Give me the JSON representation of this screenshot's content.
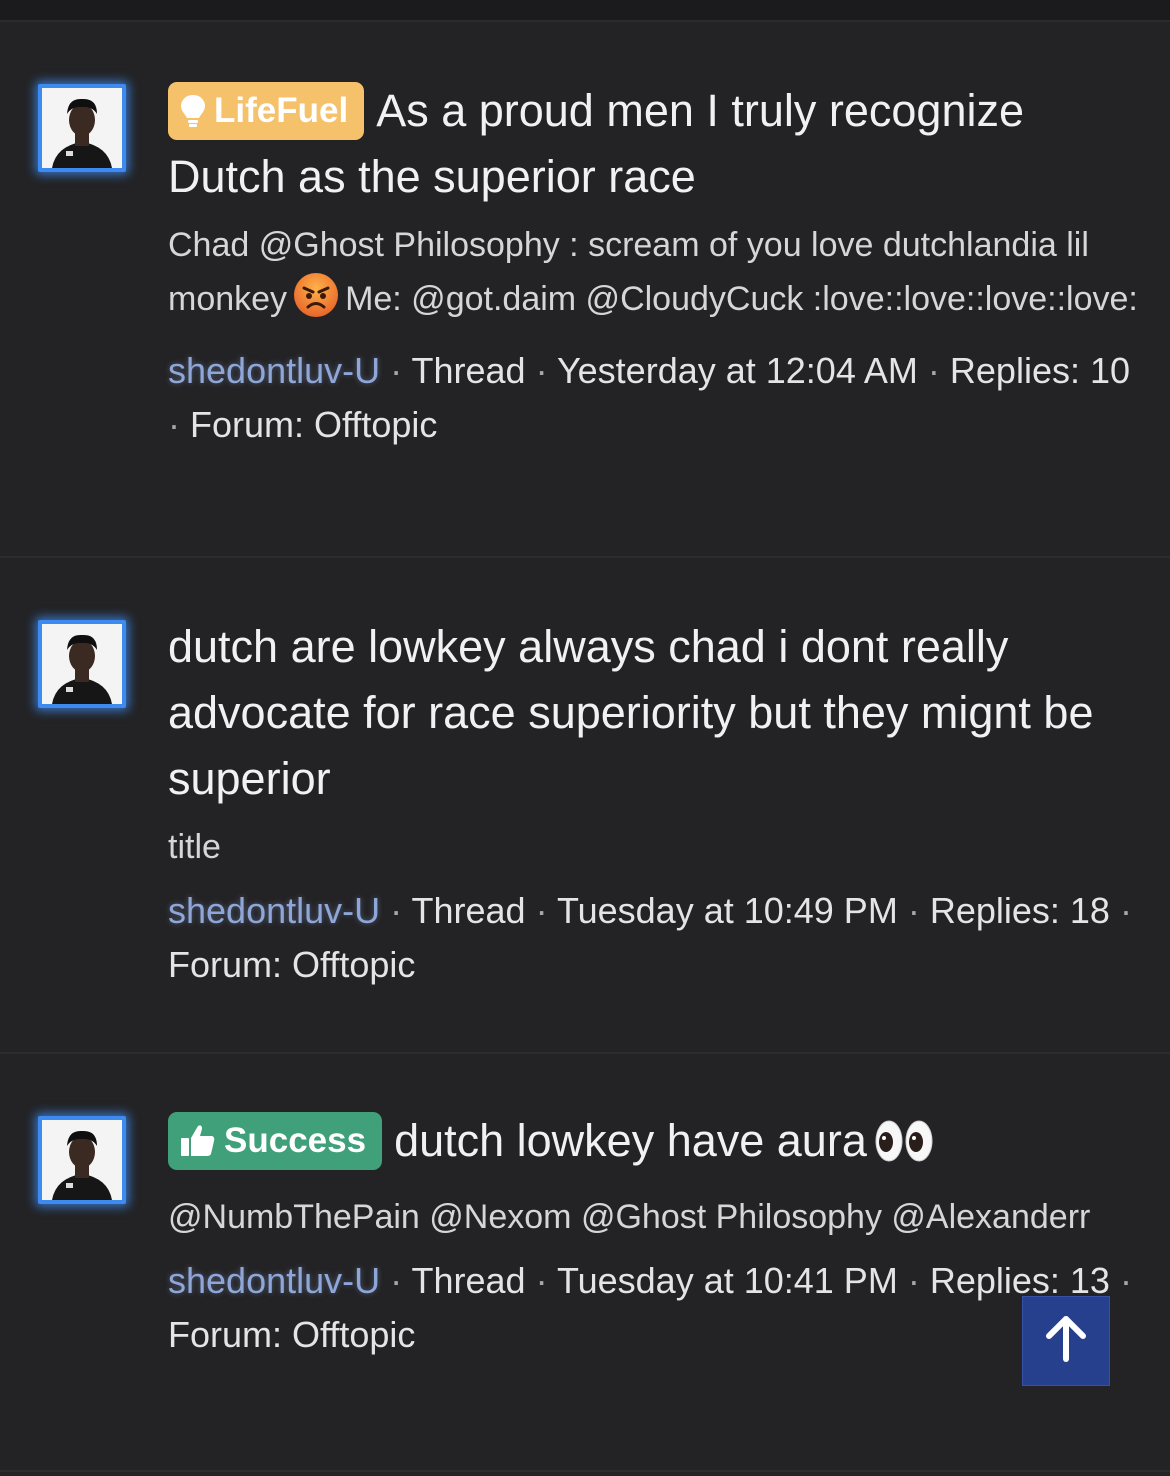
{
  "results": [
    {
      "prefix": {
        "label": "LifeFuel",
        "icon": "lightbulb-icon",
        "color": "#f5c16a"
      },
      "title": "As a proud men I truly recognize Dutch as the superior race",
      "snippet_part1": "Chad @Ghost Philosophy : scream of you love dutchlandia lil monkey",
      "snippet_emoji": "angry-face-emoji",
      "snippet_part2": "Me: @got.daim @CloudyCuck :love::love::love::love:",
      "username": "shedontluv-U",
      "content_type": "Thread",
      "date": "Yesterday at 12:04 AM",
      "replies": "Replies: 10",
      "forum": "Forum: Offtopic"
    },
    {
      "title": "dutch are lowkey always chad i dont really advocate for race superiority but they mignt be superior",
      "snippet": "title",
      "username": "shedontluv-U",
      "content_type": "Thread",
      "date": "Tuesday at 10:49 PM",
      "replies": "Replies: 18",
      "forum": "Forum: Offtopic"
    },
    {
      "prefix": {
        "label": "Success",
        "icon": "thumbs-up-icon",
        "color": "#3fa07a"
      },
      "title": "dutch lowkey have aura",
      "title_emoji": "eyes-emoji",
      "snippet": "@NumbThePain @Nexom @Ghost Philosophy @Alexanderr",
      "username": "shedontluv-U",
      "content_type": "Thread",
      "date": "Tuesday at 10:41 PM",
      "replies": "Replies: 13",
      "forum": "Forum: Offtopic"
    }
  ],
  "separator": "·",
  "scroll_top_icon": "arrow-up-icon",
  "colors": {
    "background": "#232325",
    "avatar_border": "#3d8bf0",
    "username": "#8fa6d8",
    "scroll_button": "#284396"
  }
}
